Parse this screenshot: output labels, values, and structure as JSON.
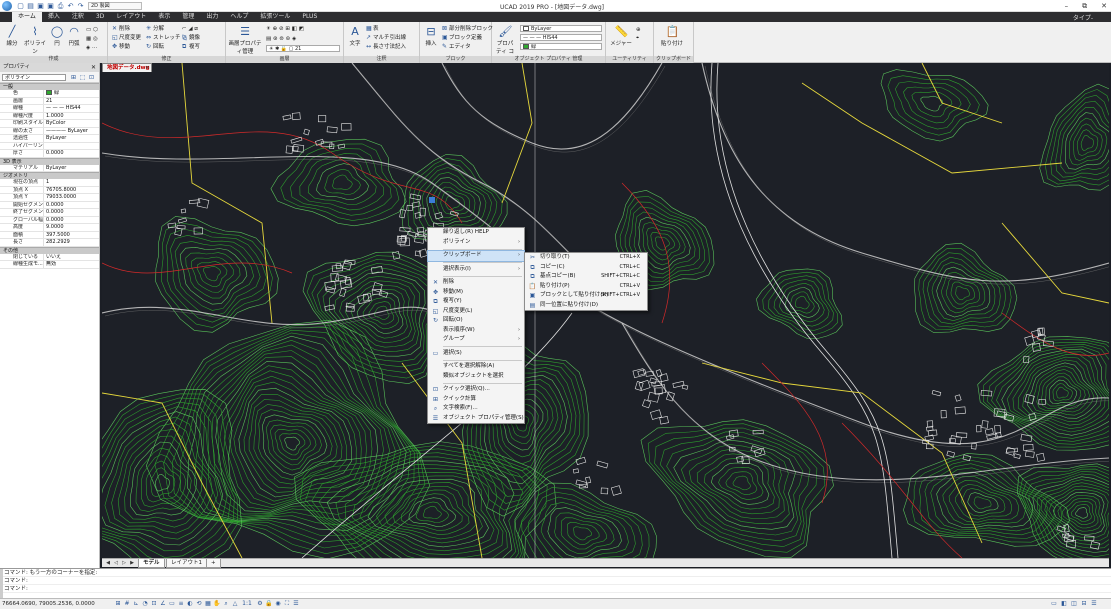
{
  "title_bar": {
    "app_title": "UCAD 2019 PRO - [地図データ.dwg]",
    "workspace": "2D 製図",
    "window_controls": [
      "–",
      "⧉",
      "✕"
    ]
  },
  "ribbon_tabs": {
    "tabs": [
      "ホーム",
      "挿入",
      "注釈",
      "3D",
      "レイアウト",
      "表示",
      "管理",
      "出力",
      "ヘルプ",
      "拡張ツール",
      "PLUS"
    ],
    "active": "ホーム",
    "right_label": "タイプ-"
  },
  "ribbon": {
    "draw": {
      "title": "作成",
      "line": "線分",
      "polyline": "ポリライン",
      "circle": "円",
      "arc": "円弧"
    },
    "modify": {
      "title": "修正",
      "erase": "削除",
      "explode": "分解",
      "scale": "尺度変更",
      "stretch": "ストレッチ",
      "move": "移動",
      "rotate": "回転",
      "mirror": "鏡像",
      "copy": "複写"
    },
    "layers": {
      "title": "画層",
      "layer_props": "画層プロパティ管理",
      "layer_value": "21"
    },
    "annotation": {
      "title": "注釈",
      "text": "文字",
      "table": "表",
      "mleader": "マルチ引出線",
      "linear_dim": "長さ寸法記入"
    },
    "block": {
      "title": "ブロック",
      "insert": "挿入",
      "create": "部分削除ブロック",
      "define": "ブロック定義",
      "editor": "エディタ"
    },
    "properties": {
      "title": "オブジェクト プロパティ 管理",
      "match": "プロパティ コピー",
      "color": "ByLayer",
      "linetype": "HIS44",
      "lineweight": "緑"
    },
    "utilities": {
      "title": "ユーティリティ",
      "measure": "メジャー"
    },
    "clipboard": {
      "title": "クリップボード",
      "paste": "貼り付け"
    }
  },
  "properties_palette": {
    "title": "プロパティ",
    "selected_type": "ポリライン",
    "sections": [
      {
        "name": "一般",
        "rows": [
          {
            "k": "色",
            "v": "緑"
          },
          {
            "k": "画層",
            "v": "21"
          },
          {
            "k": "線種",
            "v": "— — — HIS44"
          },
          {
            "k": "線種尺度",
            "v": "1.0000"
          },
          {
            "k": "印刷スタイル",
            "v": "ByColor"
          },
          {
            "k": "線の太さ",
            "v": "———— ByLayer"
          },
          {
            "k": "透過性",
            "v": "ByLayer"
          },
          {
            "k": "ハイパーリンク",
            "v": ""
          },
          {
            "k": "厚さ",
            "v": "0.0000"
          }
        ]
      },
      {
        "name": "3D 表示",
        "rows": [
          {
            "k": "マテリアル",
            "v": "ByLayer"
          }
        ]
      },
      {
        "name": "ジオメトリ",
        "rows": [
          {
            "k": "現在の頂点",
            "v": "1"
          },
          {
            "k": "頂点 X",
            "v": "76705.8000"
          },
          {
            "k": "頂点 Y",
            "v": "79033.0000"
          },
          {
            "k": "開始セグメン...",
            "v": "0.0000"
          },
          {
            "k": "終了セグメン...",
            "v": "0.0000"
          },
          {
            "k": "グローバル幅",
            "v": "0.0000"
          },
          {
            "k": "高度",
            "v": "9.0000"
          },
          {
            "k": "面積",
            "v": "397.5000"
          },
          {
            "k": "長さ",
            "v": "282.2929"
          }
        ]
      },
      {
        "name": "その他",
        "rows": [
          {
            "k": "閉じている",
            "v": "いいえ"
          },
          {
            "k": "線種生成モ...",
            "v": "無効"
          }
        ]
      }
    ]
  },
  "document": {
    "tab_name": "地図データ.dwg"
  },
  "layout_tabs": {
    "tabs": [
      "モデル",
      "レイアウト1"
    ],
    "active": "モデル",
    "add": "+"
  },
  "command_line": {
    "lines": [
      "コマンド: もう一方のコーナーを指定:",
      "コマンド:",
      "コマンド:"
    ]
  },
  "status_bar": {
    "coords": "76664.0690, 79005.2536, 0.0000",
    "scale": "1:1"
  },
  "context_menu": {
    "items": [
      {
        "label": "繰り返し(R) HELP",
        "icon": "",
        "sub": false
      },
      {
        "label": "ポリライン",
        "icon": "",
        "sub": true
      },
      {
        "sep": true
      },
      {
        "label": "クリップボード",
        "icon": "",
        "sub": true,
        "highlight": true
      },
      {
        "sep": true
      },
      {
        "label": "選択表示(I)",
        "icon": "",
        "sub": true
      },
      {
        "sep": true
      },
      {
        "label": "削除",
        "icon": "✕",
        "sub": false
      },
      {
        "label": "移動(M)",
        "icon": "✥",
        "sub": false
      },
      {
        "label": "複写(Y)",
        "icon": "⧉",
        "sub": false
      },
      {
        "label": "尺度変更(L)",
        "icon": "◱",
        "sub": false
      },
      {
        "label": "回転(O)",
        "icon": "↻",
        "sub": false
      },
      {
        "label": "表示順序(W)",
        "icon": "",
        "sub": true
      },
      {
        "label": "グループ",
        "icon": "",
        "sub": true
      },
      {
        "sep": true
      },
      {
        "label": "選択(S)",
        "icon": "▭",
        "sub": false
      },
      {
        "sep": true
      },
      {
        "label": "すべてを選択解除(A)",
        "icon": "",
        "sub": false
      },
      {
        "label": "類似オブジェクトを選択",
        "icon": "",
        "sub": false
      },
      {
        "sep": true
      },
      {
        "label": "クイック選択(Q)...",
        "icon": "⊡",
        "sub": false
      },
      {
        "label": "クイック計算",
        "icon": "⊞",
        "sub": false
      },
      {
        "label": "文字検索(F)...",
        "icon": "⌕",
        "sub": false
      },
      {
        "label": "オブジェクト プロパティ管理(S)",
        "icon": "☰",
        "sub": false
      }
    ]
  },
  "clipboard_submenu": {
    "items": [
      {
        "label": "切り取り(T)",
        "shortcut": "CTRL+X",
        "icon": "✂"
      },
      {
        "label": "コピー(C)",
        "shortcut": "CTRL+C",
        "icon": "⧉"
      },
      {
        "label": "基点コピー(B)",
        "shortcut": "SHIFT+CTRL+C",
        "icon": "⧉"
      },
      {
        "label": "貼り付け(P)",
        "shortcut": "CTRL+V",
        "icon": "📋"
      },
      {
        "label": "ブロックとして貼り付け(K)",
        "shortcut": "SHIFT+CTRL+V",
        "icon": "▣"
      },
      {
        "label": "同一位置に貼り付け(D)",
        "shortcut": "",
        "icon": "▤"
      }
    ]
  },
  "colors": {
    "ribbon_bg": "#f0f0f0",
    "tabs_bg": "#2d2d30",
    "canvas_bg": "#1d2027",
    "contour": "#2faa2f",
    "building": "#e8e8e8",
    "road_yellow": "#e6d83c",
    "red_line": "#d42a2a"
  }
}
